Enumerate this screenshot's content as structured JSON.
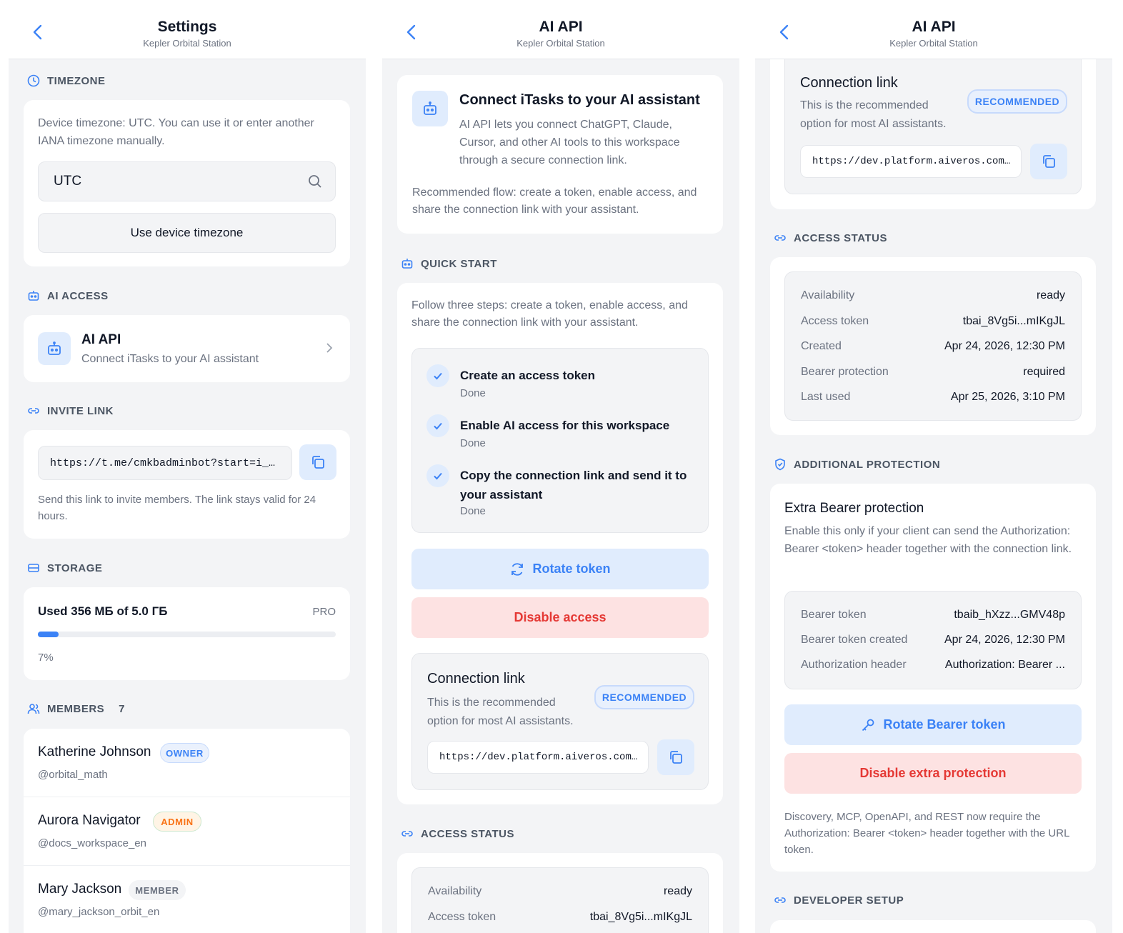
{
  "panel1": {
    "header": {
      "title": "Settings",
      "subtitle": "Kepler Orbital Station"
    },
    "timezone": {
      "section_label": "TIMEZONE",
      "description": "Device timezone: UTC. You can use it or enter another IANA timezone manually.",
      "input_value": "UTC",
      "use_device_button": "Use device timezone"
    },
    "ai_access": {
      "section_label": "AI ACCESS",
      "item_title": "AI API",
      "item_subtitle": "Connect iTasks to your AI assistant"
    },
    "invite": {
      "section_label": "INVITE LINK",
      "link": "https://t.me/cmkbadminbot?start=i_…",
      "note": "Send this link to invite members. The link stays valid for 24 hours."
    },
    "storage": {
      "section_label": "STORAGE",
      "used": "Used 356 МБ of 5.0 ГБ",
      "plan": "PRO",
      "percent_label": "7%",
      "percent": 7
    },
    "members": {
      "section_label": "MEMBERS",
      "count": "7",
      "list": [
        {
          "name": "Katherine Johnson",
          "role": "OWNER",
          "handle": "@orbital_math"
        },
        {
          "name": "Aurora Navigator",
          "role": "ADMIN",
          "handle": "@docs_workspace_en"
        },
        {
          "name": "Mary Jackson",
          "role": "MEMBER",
          "handle": "@mary_jackson_orbit_en"
        }
      ]
    }
  },
  "panel2": {
    "header": {
      "title": "AI API",
      "subtitle": "Kepler Orbital Station"
    },
    "intro": {
      "title": "Connect iTasks to your AI assistant",
      "body": "AI API lets you connect ChatGPT, Claude, Cursor, and other AI tools to this workspace through a secure connection link.",
      "flow": "Recommended flow: create a token, enable access, and share the connection link with your assistant."
    },
    "quick_start": {
      "section_label": "QUICK START",
      "description": "Follow three steps: create a token, enable access, and share the connection link with your assistant.",
      "steps": [
        {
          "title": "Create an access token",
          "status": "Done"
        },
        {
          "title": "Enable AI access for this workspace",
          "status": "Done"
        },
        {
          "title": "Copy the connection link and send it to your assistant",
          "status": "Done"
        }
      ],
      "rotate_button": "Rotate token",
      "disable_button": "Disable access"
    },
    "connection": {
      "title": "Connection link",
      "subtitle": "This is the recommended option for most AI assistants.",
      "badge": "RECOMMENDED",
      "link": "https://dev.platform.aiveros.com…"
    },
    "access_status": {
      "section_label": "ACCESS STATUS",
      "rows": [
        {
          "key": "Availability",
          "value": "ready"
        },
        {
          "key": "Access token",
          "value": "tbai_8Vg5i...mIKgJL"
        }
      ]
    }
  },
  "panel3": {
    "header": {
      "title": "AI API",
      "subtitle": "Kepler Orbital Station"
    },
    "connection": {
      "title": "Connection link",
      "subtitle": "This is the recommended option for most AI assistants.",
      "badge": "RECOMMENDED",
      "link": "https://dev.platform.aiveros.com…"
    },
    "access_status": {
      "section_label": "ACCESS STATUS",
      "rows": [
        {
          "key": "Availability",
          "value": "ready"
        },
        {
          "key": "Access token",
          "value": "tbai_8Vg5i...mIKgJL"
        },
        {
          "key": "Created",
          "value": "Apr 24, 2026, 12:30 PM"
        },
        {
          "key": "Bearer protection",
          "value": "required"
        },
        {
          "key": "Last used",
          "value": "Apr 25, 2026, 3:10 PM"
        }
      ]
    },
    "additional_protection": {
      "section_label": "ADDITIONAL PROTECTION",
      "title": "Extra Bearer protection",
      "description": "Enable this only if your client can send the Authorization: Bearer <token> header together with the connection link.",
      "rows": [
        {
          "key": "Bearer token",
          "value": "tbaib_hXzz...GMV48p"
        },
        {
          "key": "Bearer token created",
          "value": "Apr 24, 2026, 12:30 PM"
        },
        {
          "key": "Authorization header",
          "value": "Authorization: Bearer ..."
        }
      ],
      "rotate_button": "Rotate Bearer token",
      "disable_button": "Disable extra protection",
      "note": "Discovery, MCP, OpenAPI, and REST now require the Authorization: Bearer <token> header together with the URL token."
    },
    "developer_setup": {
      "section_label": "DEVELOPER SETUP"
    }
  },
  "colors": {
    "accent": "#3b82f6",
    "danger": "#e53935",
    "background": "#f3f4f6"
  }
}
